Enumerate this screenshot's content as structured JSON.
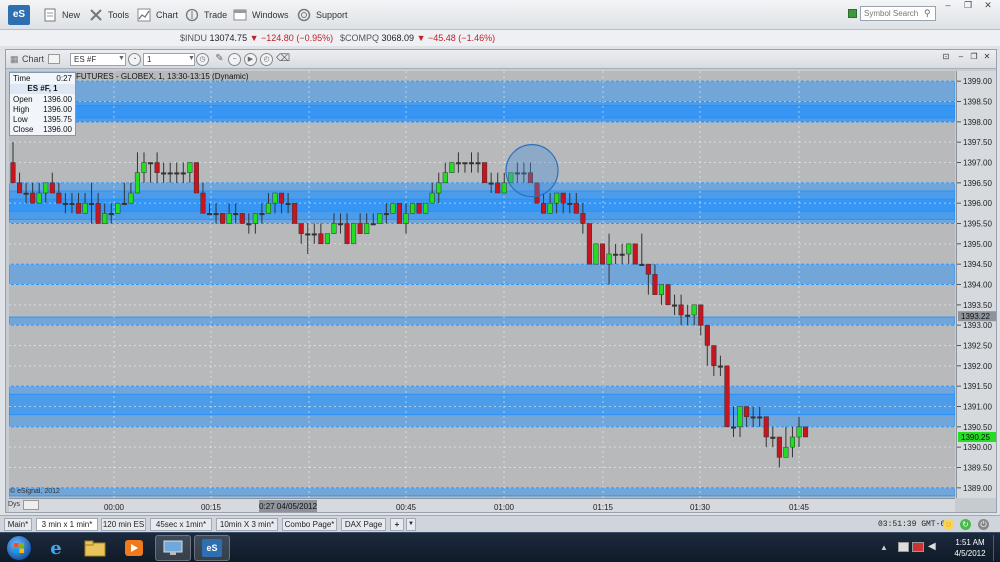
{
  "toolbar": {
    "logo": "eS",
    "items": [
      {
        "label": "New",
        "icon": "new-document-icon"
      },
      {
        "label": "Tools",
        "icon": "tools-icon"
      },
      {
        "label": "Chart",
        "icon": "chart-icon"
      },
      {
        "label": "Trade",
        "icon": "trade-icon"
      },
      {
        "label": "Windows",
        "icon": "windows-icon"
      },
      {
        "label": "Support",
        "icon": "support-icon"
      }
    ],
    "search_placeholder": "Symbol Search"
  },
  "ticker": [
    {
      "symbol": "$INDU",
      "price": "13074.75",
      "change": "−124.80 (−0.95%)"
    },
    {
      "symbol": "$COMPQ",
      "price": "3068.09",
      "change": "−45.48 (−1.46%)"
    }
  ],
  "chart_window": {
    "title": "Chart",
    "symbol_input": "ES #F",
    "interval_input": "1",
    "caption": "FUTURES - GLOBEX, 1, 13:30-13:15 (Dynamic)",
    "copyright": "© eSignal, 2012",
    "dys_label": "Dys"
  },
  "data_window": {
    "time_label": "Time",
    "time_value": "0:27",
    "symbol": "ES #F, 1",
    "rows": [
      {
        "label": "Open",
        "value": "1396.00"
      },
      {
        "label": "High",
        "value": "1396.00"
      },
      {
        "label": "Low",
        "value": "1395.75"
      },
      {
        "label": "Close",
        "value": "1396.00"
      }
    ]
  },
  "chart_data": {
    "type": "candlestick",
    "ylim": [
      1388.75,
      1399.25
    ],
    "y_ticks": [
      "1399.00",
      "1398.50",
      "1398.00",
      "1397.50",
      "1397.00",
      "1396.50",
      "1396.00",
      "1395.50",
      "1395.00",
      "1394.50",
      "1394.00",
      "1393.50",
      "1393.00",
      "1392.50",
      "1392.00",
      "1391.50",
      "1391.00",
      "1390.50",
      "1390.00",
      "1389.50",
      "1389.00"
    ],
    "x_ticks": [
      "00:00",
      "00:15",
      "00:45",
      "01:00",
      "01:15",
      "01:30",
      "01:45"
    ],
    "cursor_time_label": "0:27 04/05/2012",
    "last_price_label": "1390.25",
    "crosshair_price_label": "1393.22",
    "colors": {
      "up": "#22dd22",
      "down": "#c8141e",
      "zone": "#1e90ff",
      "background": "#b7b9bb"
    },
    "zones": [
      [
        1398.0,
        1399.0
      ],
      [
        1398.0,
        1398.5
      ],
      [
        1398.1,
        1398.4
      ],
      [
        1395.5,
        1396.5
      ],
      [
        1395.6,
        1396.3
      ],
      [
        1395.8,
        1396.1
      ],
      [
        1394.0,
        1394.5
      ],
      [
        1393.0,
        1393.2
      ],
      [
        1391.5,
        1390.5
      ],
      [
        1390.8,
        1391.3
      ],
      [
        1389.0,
        1388.8
      ]
    ],
    "candles": [
      [
        1397.0,
        1397.5,
        1396.5,
        1396.5
      ],
      [
        1396.5,
        1396.75,
        1396.25,
        1396.25
      ],
      [
        1396.25,
        1396.5,
        1396.0,
        1396.25
      ],
      [
        1396.25,
        1396.5,
        1396.0,
        1396.0
      ],
      [
        1396.0,
        1396.5,
        1396.0,
        1396.25
      ],
      [
        1396.25,
        1396.5,
        1396.0,
        1396.5
      ],
      [
        1396.5,
        1396.75,
        1396.25,
        1396.25
      ],
      [
        1396.25,
        1396.5,
        1396.0,
        1396.0
      ],
      [
        1396.0,
        1396.25,
        1395.75,
        1396.0
      ],
      [
        1396.0,
        1396.25,
        1395.75,
        1396.0
      ],
      [
        1396.0,
        1396.25,
        1395.75,
        1395.75
      ],
      [
        1395.75,
        1396.25,
        1395.75,
        1396.0
      ],
      [
        1396.0,
        1396.5,
        1395.5,
        1396.0
      ],
      [
        1396.0,
        1396.25,
        1395.5,
        1395.5
      ],
      [
        1395.5,
        1396.0,
        1395.5,
        1395.75
      ],
      [
        1395.75,
        1396.0,
        1395.5,
        1395.75
      ],
      [
        1395.75,
        1396.0,
        1395.75,
        1396.0
      ],
      [
        1396.0,
        1396.5,
        1396.0,
        1396.0
      ],
      [
        1396.0,
        1396.5,
        1396.0,
        1396.25
      ],
      [
        1396.25,
        1397.25,
        1396.25,
        1396.75
      ],
      [
        1396.75,
        1397.25,
        1396.5,
        1397.0
      ],
      [
        1397.0,
        1397.0,
        1396.5,
        1397.0
      ],
      [
        1397.0,
        1397.25,
        1396.5,
        1396.75
      ],
      [
        1396.75,
        1397.0,
        1396.5,
        1396.75
      ],
      [
        1396.75,
        1397.0,
        1396.5,
        1396.75
      ],
      [
        1396.75,
        1397.0,
        1396.5,
        1396.75
      ],
      [
        1396.75,
        1397.0,
        1396.5,
        1396.75
      ],
      [
        1396.75,
        1397.0,
        1396.5,
        1397.0
      ],
      [
        1397.0,
        1397.0,
        1396.25,
        1396.25
      ],
      [
        1396.25,
        1396.5,
        1395.75,
        1395.75
      ],
      [
        1395.75,
        1396.0,
        1395.75,
        1395.75
      ],
      [
        1395.75,
        1396.0,
        1395.5,
        1395.75
      ],
      [
        1395.75,
        1395.75,
        1395.5,
        1395.5
      ],
      [
        1395.5,
        1396.0,
        1395.5,
        1395.75
      ],
      [
        1395.75,
        1396.0,
        1395.5,
        1395.75
      ],
      [
        1395.75,
        1395.75,
        1395.5,
        1395.5
      ],
      [
        1395.5,
        1395.75,
        1395.25,
        1395.5
      ],
      [
        1395.5,
        1395.75,
        1395.25,
        1395.75
      ],
      [
        1395.75,
        1396.0,
        1395.5,
        1395.75
      ],
      [
        1395.75,
        1396.25,
        1395.75,
        1396.0
      ],
      [
        1396.0,
        1396.25,
        1395.75,
        1396.25
      ],
      [
        1396.25,
        1396.25,
        1395.75,
        1396.0
      ],
      [
        1396.0,
        1396.25,
        1395.75,
        1396.0
      ],
      [
        1396.0,
        1396.0,
        1395.5,
        1395.5
      ],
      [
        1395.5,
        1395.5,
        1395.0,
        1395.25
      ],
      [
        1395.25,
        1395.5,
        1394.75,
        1395.25
      ],
      [
        1395.25,
        1395.5,
        1395.0,
        1395.25
      ],
      [
        1395.25,
        1395.5,
        1395.0,
        1395.0
      ],
      [
        1395.0,
        1395.25,
        1395.0,
        1395.25
      ],
      [
        1395.25,
        1395.75,
        1395.25,
        1395.5
      ],
      [
        1395.5,
        1395.75,
        1395.25,
        1395.5
      ],
      [
        1395.5,
        1395.75,
        1395.0,
        1395.0
      ],
      [
        1395.0,
        1395.5,
        1395.0,
        1395.5
      ],
      [
        1395.5,
        1395.75,
        1395.25,
        1395.25
      ],
      [
        1395.25,
        1395.75,
        1395.25,
        1395.5
      ],
      [
        1395.5,
        1395.75,
        1395.5,
        1395.5
      ],
      [
        1395.5,
        1395.75,
        1395.5,
        1395.75
      ],
      [
        1395.75,
        1396.0,
        1395.5,
        1395.75
      ],
      [
        1395.75,
        1396.0,
        1395.75,
        1396.0
      ],
      [
        1396.0,
        1396.0,
        1395.5,
        1395.5
      ],
      [
        1395.5,
        1396.0,
        1395.25,
        1395.75
      ],
      [
        1395.75,
        1396.0,
        1395.75,
        1396.0
      ],
      [
        1396.0,
        1396.0,
        1395.75,
        1395.75
      ],
      [
        1395.75,
        1396.0,
        1395.75,
        1396.0
      ],
      [
        1396.0,
        1396.5,
        1396.0,
        1396.25
      ],
      [
        1396.25,
        1396.75,
        1396.0,
        1396.5
      ],
      [
        1396.5,
        1397.0,
        1396.5,
        1396.75
      ],
      [
        1396.75,
        1397.0,
        1396.75,
        1397.0
      ],
      [
        1397.0,
        1397.25,
        1396.75,
        1397.0
      ],
      [
        1397.0,
        1397.0,
        1396.75,
        1397.0
      ],
      [
        1397.0,
        1397.25,
        1396.75,
        1397.0
      ],
      [
        1397.0,
        1397.25,
        1396.75,
        1397.0
      ],
      [
        1397.0,
        1397.0,
        1396.5,
        1396.5
      ],
      [
        1396.5,
        1396.75,
        1396.25,
        1396.5
      ],
      [
        1396.5,
        1396.75,
        1396.25,
        1396.25
      ],
      [
        1396.25,
        1396.75,
        1396.25,
        1396.5
      ],
      [
        1396.5,
        1396.75,
        1396.5,
        1396.75
      ],
      [
        1396.75,
        1397.0,
        1396.5,
        1396.75
      ],
      [
        1396.75,
        1397.0,
        1396.5,
        1396.75
      ],
      [
        1396.75,
        1397.0,
        1396.5,
        1396.5
      ],
      [
        1396.5,
        1396.5,
        1396.0,
        1396.0
      ],
      [
        1396.0,
        1396.25,
        1395.75,
        1395.75
      ],
      [
        1395.75,
        1396.25,
        1395.75,
        1396.0
      ],
      [
        1396.0,
        1396.25,
        1395.75,
        1396.25
      ],
      [
        1396.25,
        1396.25,
        1395.75,
        1396.0
      ],
      [
        1396.0,
        1396.25,
        1395.75,
        1396.0
      ],
      [
        1396.0,
        1396.25,
        1395.75,
        1395.75
      ],
      [
        1395.75,
        1396.0,
        1395.25,
        1395.5
      ],
      [
        1395.5,
        1395.5,
        1394.5,
        1394.5
      ],
      [
        1394.5,
        1395.0,
        1394.5,
        1395.0
      ],
      [
        1395.0,
        1395.0,
        1394.5,
        1394.5
      ],
      [
        1394.5,
        1395.25,
        1394.0,
        1394.75
      ],
      [
        1394.75,
        1395.0,
        1394.5,
        1394.75
      ],
      [
        1394.75,
        1395.0,
        1394.5,
        1394.75
      ],
      [
        1394.75,
        1395.0,
        1394.5,
        1395.0
      ],
      [
        1395.0,
        1395.0,
        1394.5,
        1394.5
      ],
      [
        1394.5,
        1395.25,
        1394.5,
        1394.5
      ],
      [
        1394.5,
        1394.5,
        1393.75,
        1394.25
      ],
      [
        1394.25,
        1394.5,
        1393.75,
        1393.75
      ],
      [
        1393.75,
        1394.0,
        1393.5,
        1394.0
      ],
      [
        1394.0,
        1394.0,
        1393.5,
        1393.5
      ],
      [
        1393.5,
        1393.75,
        1393.25,
        1393.5
      ],
      [
        1393.5,
        1393.75,
        1393.0,
        1393.25
      ],
      [
        1393.25,
        1393.5,
        1393.0,
        1393.25
      ],
      [
        1393.25,
        1393.5,
        1393.0,
        1393.5
      ],
      [
        1393.5,
        1393.5,
        1392.75,
        1393.0
      ],
      [
        1393.0,
        1393.0,
        1392.0,
        1392.5
      ],
      [
        1392.5,
        1392.5,
        1391.75,
        1392.0
      ],
      [
        1392.0,
        1392.25,
        1391.75,
        1392.0
      ],
      [
        1392.0,
        1392.0,
        1390.5,
        1390.5
      ],
      [
        1390.5,
        1391.0,
        1390.25,
        1390.5
      ],
      [
        1390.5,
        1391.0,
        1390.25,
        1391.0
      ],
      [
        1391.0,
        1391.0,
        1390.5,
        1390.75
      ],
      [
        1390.75,
        1391.0,
        1390.5,
        1390.75
      ],
      [
        1390.75,
        1391.0,
        1390.5,
        1390.75
      ],
      [
        1390.75,
        1390.75,
        1390.0,
        1390.25
      ],
      [
        1390.25,
        1390.5,
        1390.0,
        1390.25
      ],
      [
        1390.25,
        1390.25,
        1389.5,
        1389.75
      ],
      [
        1389.75,
        1390.5,
        1389.75,
        1390.0
      ],
      [
        1390.0,
        1390.5,
        1389.75,
        1390.25
      ],
      [
        1390.25,
        1390.75,
        1390.0,
        1390.5
      ],
      [
        1390.5,
        1390.5,
        1390.25,
        1390.25
      ]
    ]
  },
  "tabs": [
    {
      "label": "Main*",
      "active": false
    },
    {
      "label": "3 min x 1 min*",
      "active": true
    },
    {
      "label": "120 min ES",
      "active": false
    },
    {
      "label": "45sec x 1min*",
      "active": false
    },
    {
      "label": "10min X 3 min*",
      "active": false
    },
    {
      "label": "Combo Page*",
      "active": false
    },
    {
      "label": "DAX Page",
      "active": false
    }
  ],
  "status": {
    "clock": "03:51:39 GMT-6"
  },
  "taskbar": {
    "time": "1:51 AM",
    "date": "4/5/2012"
  }
}
